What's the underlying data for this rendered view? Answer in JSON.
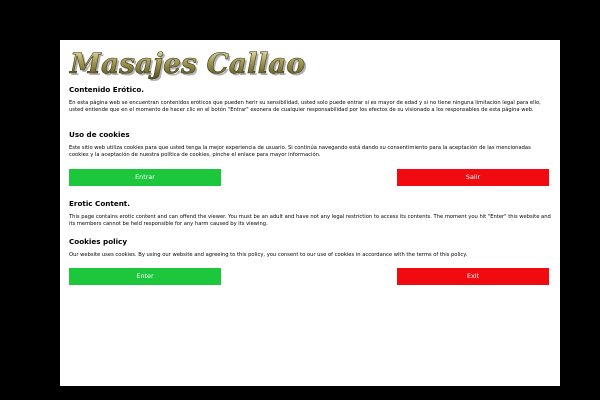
{
  "logo": {
    "text": "Masajes Callao"
  },
  "spanish": {
    "title": "Contenido Erótico.",
    "body": "En esta página web se encuentran contenidos eróticos que pueden herir su sensibilidad, usted solo puede entrar si es mayor de edad y si no tiene ninguna limitación legal para ello, usted entiende que en el momento de hacer clic en el botón \"Entrar\" exonera de cualquier responsabilidad por los efectos de su visionado a los responsables de esta página web.",
    "cookies_title": "Uso de cookies",
    "cookies_body": "Este sitio web utiliza cookies para que usted tenga la mejor experiencia de usuario. Si continúa navegando está dando su consentimiento para la aceptación de las mencionadas cookies y la aceptación de nuestra política de cookies, pinche el enlace para mayor información.",
    "enter_label": "Entrar",
    "exit_label": "Salir"
  },
  "english": {
    "title": "Erotic Content.",
    "body": "This page contains erotic content and can offend the viewer. You must be an adult and have not any legal restriction to access its contents. The moment you hit \"Enter\" this website and its members cannot be held responsible for any harm caused by its viewing.",
    "cookies_title": "Cookies policy",
    "cookies_body": "Our website uses cookies. By using our website and agreeing to this policy, you consent to our use of cookies in accordance with the terms of this policy.",
    "enter_label": "Enter",
    "exit_label": "Exit"
  },
  "colors": {
    "enter_button": "#1dc73c",
    "exit_button": "#f10b10",
    "overlay": "#000000",
    "modal": "#ffffff"
  }
}
